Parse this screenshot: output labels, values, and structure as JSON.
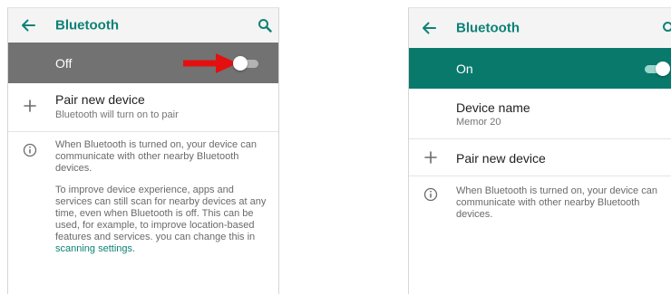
{
  "left_screen": {
    "title": "Bluetooth",
    "status_label": "Off",
    "pair": {
      "title": "Pair new device",
      "subtitle": "Bluetooth will turn on to pair"
    },
    "info_paragraph_1": "When Bluetooth is turned on, your device can communicate with other nearby Bluetooth devices.",
    "info_paragraph_2": "To improve device experience, apps and services can still scan for nearby devices at any time, even when Bluetooth is off. This can be used, for example, to improve location-based features and services. you can change this in",
    "info_link": "scanning settings",
    "info_period": "."
  },
  "right_screen": {
    "title": "Bluetooth",
    "status_label": "On",
    "device_name": {
      "title": "Device name",
      "value": "Memor 20"
    },
    "pair": {
      "title": "Pair new device"
    },
    "info_paragraph_1": "When Bluetooth is turned on, your device can communicate with other nearby Bluetooth devices."
  },
  "colors": {
    "accent": "#0e8276",
    "bar_off": "#727272",
    "bar_on": "#09796c",
    "arrow": "#e41010"
  },
  "icons": [
    "back-arrow-icon",
    "search-icon",
    "plus-icon",
    "info-icon",
    "red-arrow-icon"
  ]
}
